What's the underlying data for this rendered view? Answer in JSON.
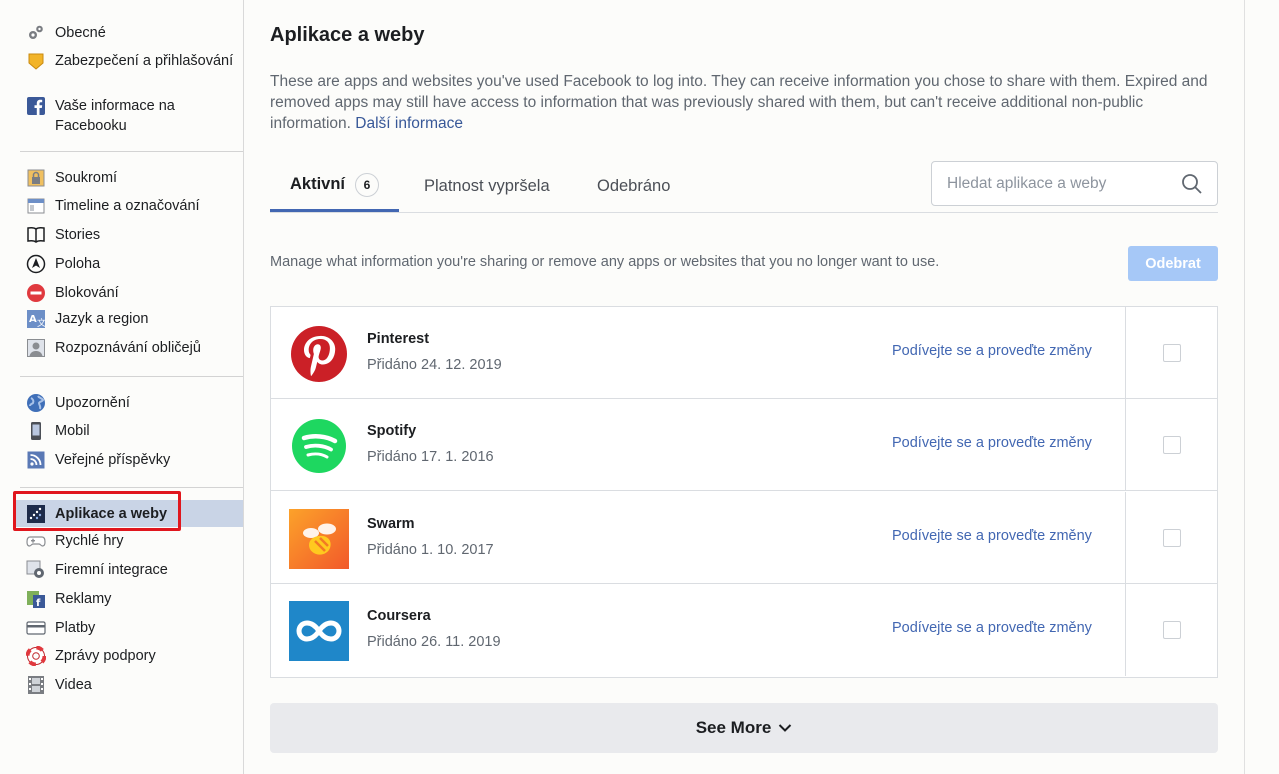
{
  "sidebar": {
    "group1": [
      {
        "label": "Obecné",
        "icon": "gears-icon"
      },
      {
        "label": "Zabezpečení a přihlašování",
        "icon": "shield-badge-icon"
      },
      {
        "label": "Vaše informace na Facebooku",
        "icon": "facebook-icon"
      }
    ],
    "group2": [
      {
        "label": "Soukromí",
        "icon": "lock-icon"
      },
      {
        "label": "Timeline a označování",
        "icon": "timeline-icon"
      },
      {
        "label": "Stories",
        "icon": "book-icon"
      },
      {
        "label": "Poloha",
        "icon": "location-icon"
      },
      {
        "label": "Blokování",
        "icon": "block-icon"
      },
      {
        "label": "Jazyk a region",
        "icon": "language-icon"
      },
      {
        "label": "Rozpoznávání obličejů",
        "icon": "face-icon"
      }
    ],
    "group3": [
      {
        "label": "Upozornění",
        "icon": "globe-icon"
      },
      {
        "label": "Mobil",
        "icon": "phone-icon"
      },
      {
        "label": "Veřejné příspěvky",
        "icon": "rss-icon"
      }
    ],
    "group4": [
      {
        "label": "Aplikace a weby",
        "icon": "apps-icon",
        "active": true
      },
      {
        "label": "Rychlé hry",
        "icon": "gamepad-icon"
      },
      {
        "label": "Firemní integrace",
        "icon": "business-gear-icon"
      },
      {
        "label": "Reklamy",
        "icon": "ads-icon"
      },
      {
        "label": "Platby",
        "icon": "credit-card-icon"
      },
      {
        "label": "Zprávy podpory",
        "icon": "lifebuoy-icon"
      },
      {
        "label": "Videa",
        "icon": "film-icon"
      }
    ]
  },
  "main": {
    "title": "Aplikace a weby",
    "description": "These are apps and websites you've used Facebook to log into. They can receive information you chose to share with them. Expired and removed apps may still have access to information that was previously shared with them, but can't receive additional non-public information.",
    "more_info_link": "Další informace",
    "tabs": [
      {
        "label": "Aktivní",
        "count": "6",
        "active": true
      },
      {
        "label": "Platnost vypršela"
      },
      {
        "label": "Odebráno"
      }
    ],
    "search_placeholder": "Hledat aplikace a weby",
    "manage_text": "Manage what information you're sharing or remove any apps or websites that you no longer want to use.",
    "remove_button": "Odebrat",
    "apps": [
      {
        "name": "Pinterest",
        "date": "Přidáno 24. 12. 2019",
        "link": "Podívejte se a proveďte změny",
        "logo": "pinterest-logo",
        "color": "#cb2027"
      },
      {
        "name": "Spotify",
        "date": "Přidáno 17. 1. 2016",
        "link": "Podívejte se a proveďte změny",
        "logo": "spotify-logo",
        "color": "#1ed760"
      },
      {
        "name": "Swarm",
        "date": "Přidáno 1. 10. 2017",
        "link": "Podívejte se a proveďte změny",
        "logo": "swarm-logo",
        "color": "#f57b23"
      },
      {
        "name": "Coursera",
        "date": "Přidáno 26. 11. 2019",
        "link": "Podívejte se a proveďte změny",
        "logo": "coursera-logo",
        "color": "#1f87c9"
      }
    ],
    "see_more": "See More"
  },
  "colors": {
    "accent": "#4267b2",
    "active_nav": "#c9d4e6",
    "highlight": "#e0161d",
    "remove_button_disabled": "#a6c8f7"
  }
}
